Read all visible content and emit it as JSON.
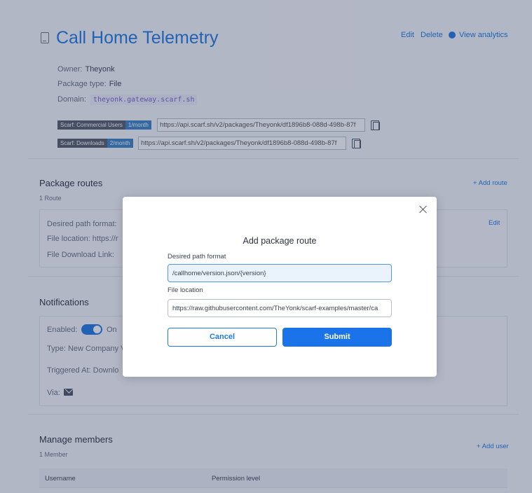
{
  "header": {
    "title": "Call Home Telemetry",
    "edit_label": "Edit",
    "delete_label": "Delete",
    "analytics_label": "View analytics"
  },
  "meta": {
    "owner_label": "Owner:",
    "owner_value": "Theyonk",
    "type_label": "Package type:",
    "type_value": "File",
    "domain_label": "Domain:",
    "domain_value": "theyonk.gateway.scarf.sh"
  },
  "badges": [
    {
      "name": "Scarf: Commercial Users",
      "value": "1/month",
      "url": "https://api.scarf.sh/v2/packages/Theyonk/df1896b8-088d-498b-87f"
    },
    {
      "name": "Scarf: Downloads",
      "value": "2/month",
      "url": "https://api.scarf.sh/v2/packages/Theyonk/df1896b8-088d-498b-87f"
    }
  ],
  "routes": {
    "title": "Package routes",
    "count": "1 Route",
    "add_label": "+ Add route",
    "edit_label": "Edit",
    "path_label": "Desired path format:",
    "file_label": "File location:  https://r",
    "download_label": "File Download Link:"
  },
  "notifications": {
    "title": "Notifications",
    "enabled_label": "Enabled:",
    "enabled_value": "On",
    "type_label": "Type:  New Company V",
    "triggered_label": "Triggered At:  Downlo",
    "via_label": "Via:"
  },
  "members": {
    "title": "Manage members",
    "count": "1 Member",
    "add_label": "+ Add user",
    "col_username": "Username",
    "col_permission": "Permission level"
  },
  "modal": {
    "title": "Add package route",
    "path_label": "Desired path format",
    "path_value": "/callhome/version.json/{version}",
    "file_label": "File location",
    "file_value": "https://raw.githubusercontent.com/TheYonk/scarf-examples/master/ca",
    "cancel_label": "Cancel",
    "submit_label": "Submit"
  },
  "colors": {
    "accent": "#1f7ae0",
    "submit": "#1a73e8",
    "overlay": "rgba(40,52,90,0.33)"
  },
  "icons": [
    "document-icon",
    "analytics-icon",
    "copy-icon",
    "mail-icon",
    "close-icon"
  ]
}
